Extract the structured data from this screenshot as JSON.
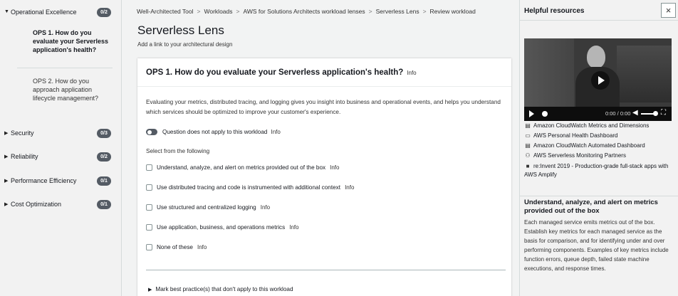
{
  "nav": {
    "sections": [
      {
        "label": "Operational Excellence",
        "badge": "0/2",
        "expanded": true
      },
      {
        "label": "Security",
        "badge": "0/3",
        "expanded": false
      },
      {
        "label": "Reliability",
        "badge": "0/2",
        "expanded": false
      },
      {
        "label": "Performance Efficiency",
        "badge": "0/1",
        "expanded": false
      },
      {
        "label": "Cost Optimization",
        "badge": "0/1",
        "expanded": false
      }
    ],
    "sub_items": [
      {
        "lines": [
          "OPS 1. How do you",
          "evaluate your Serverless",
          "application's health?"
        ],
        "active": true
      },
      {
        "lines": [
          "OPS 2. How do you",
          "approach application",
          "lifecycle management?"
        ],
        "active": false
      }
    ]
  },
  "breadcrumbs": [
    "Well-Architected Tool",
    "Workloads",
    "AWS for Solutions Architects workload lenses",
    "Serverless Lens",
    "Review workload"
  ],
  "page": {
    "title": "Serverless Lens",
    "subtitle": "Add a link to your architectural design"
  },
  "question": {
    "title": "OPS 1. How do you evaluate your Serverless application's health?",
    "info": "Info",
    "description": "Evaluating your metrics, distributed tracing, and logging gives you insight into business and operational events, and helps you understand which services should be optimized to improve your customer's experience.",
    "toggle_label": "Question does not apply to this workload",
    "select_label": "Select from the following",
    "choices": [
      "Understand, analyze, and alert on metrics provided out of the box",
      "Use distributed tracing and code is instrumented with additional context",
      "Use structured and centralized logging",
      "Use application, business, and operations metrics",
      "None of these"
    ],
    "expander_label": "Mark best practice(s) that don't apply to this workload"
  },
  "help": {
    "title": "Helpful resources",
    "close_glyph": "×",
    "video_time": "0:00 / 0:00",
    "resources": [
      {
        "icon": "document-icon",
        "glyph": "▤",
        "label": "Amazon CloudWatch Metrics and Dimensions"
      },
      {
        "icon": "dashboard-icon",
        "glyph": "▭",
        "label": "AWS Personal Health Dashboard"
      },
      {
        "icon": "document-icon",
        "glyph": "▤",
        "label": "Amazon CloudWatch Automated Dashboard"
      },
      {
        "icon": "partners-icon",
        "glyph": "⚇",
        "label": "AWS Serverless Monitoring Partners"
      },
      {
        "icon": "video-icon",
        "glyph": "■",
        "label": "re:Invent 2019 - Production-grade full-stack apps with AWS Amplify"
      }
    ],
    "section_title": "Understand, analyze, and alert on metrics provided out of the box",
    "section_body": "Each managed service emits metrics out of the box. Establish key metrics for each managed service as the basis for comparison, and for identifying under and over performing components. Examples of key metrics include function errors, queue depth, failed state machine executions, and response times."
  }
}
